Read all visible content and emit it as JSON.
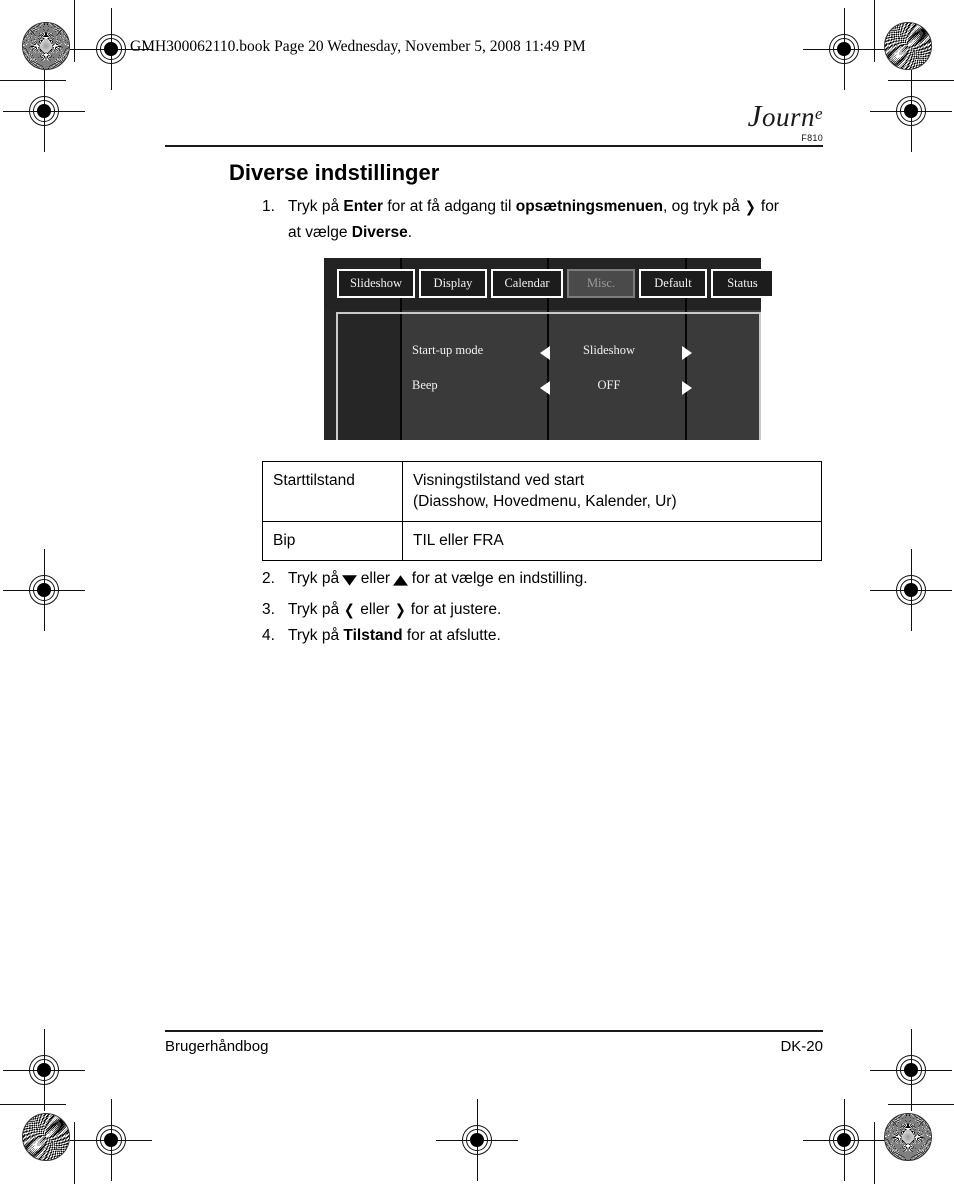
{
  "header": {
    "file_info": "GMH300062110.book  Page 20  Wednesday, November 5, 2008  11:49 PM"
  },
  "logo": {
    "brand_cap": "J",
    "brand_mid": "ourn",
    "brand_sup": "e",
    "model": "F810"
  },
  "title": "Diverse indstillinger",
  "steps": [
    {
      "num": "1.",
      "pre": "Tryk på ",
      "bold1": "Enter",
      "mid": " for at få adgang til ",
      "bold2": "opsætningsmenuen",
      "post": ", og tryk på ",
      "glyph": "❯",
      "post2": " for at vælge ",
      "bold3": "Diverse",
      "end": "."
    },
    {
      "num": "2.",
      "pre": "Tryk på ",
      "glyph1": "▼",
      "mid": " eller ",
      "glyph2": "▲",
      "post": " for at vælge en indstilling."
    },
    {
      "num": "3.",
      "pre": "Tryk på ",
      "glyph1": "❮",
      "mid": " eller ",
      "glyph2": "❯",
      "post": " for at justere."
    },
    {
      "num": "4.",
      "pre": "Tryk på ",
      "bold1": "Tilstand",
      "post": " for at afslutte."
    }
  ],
  "device_screen": {
    "tabs": [
      {
        "label": "Slideshow",
        "active": false
      },
      {
        "label": "Display",
        "active": false
      },
      {
        "label": "Calendar",
        "active": false
      },
      {
        "label": "Misc.",
        "active": true
      },
      {
        "label": "Default",
        "active": false
      },
      {
        "label": "Status",
        "active": false
      }
    ],
    "rows": [
      {
        "label": "Start-up mode",
        "value": "Slideshow",
        "left_arrow": "◀",
        "right_arrow": "▶"
      },
      {
        "label": "Beep",
        "value": "OFF",
        "left_arrow": "◀",
        "right_arrow": "▶"
      }
    ],
    "colors": {
      "tabbar_bg": "#232323",
      "panel_bg": "#3a3a3a",
      "panel_dark_bg": "#262626",
      "active_tab_bg": "#4a4a4a",
      "active_tab_text": "#9a9a9a",
      "tab_border": "#ffffff",
      "panel_border": "#c9c9c9"
    }
  },
  "spec_table": {
    "rows": [
      {
        "key": "Starttilstand",
        "value_line1": "Visningstilstand ved start",
        "value_line2": "(Diasshow, Hovedmenu, Kalender, Ur)"
      },
      {
        "key": "Bip",
        "value_line1": "TIL eller FRA",
        "value_line2": ""
      }
    ]
  },
  "footer": {
    "left": "Brugerhåndbog",
    "right": "DK-20"
  }
}
